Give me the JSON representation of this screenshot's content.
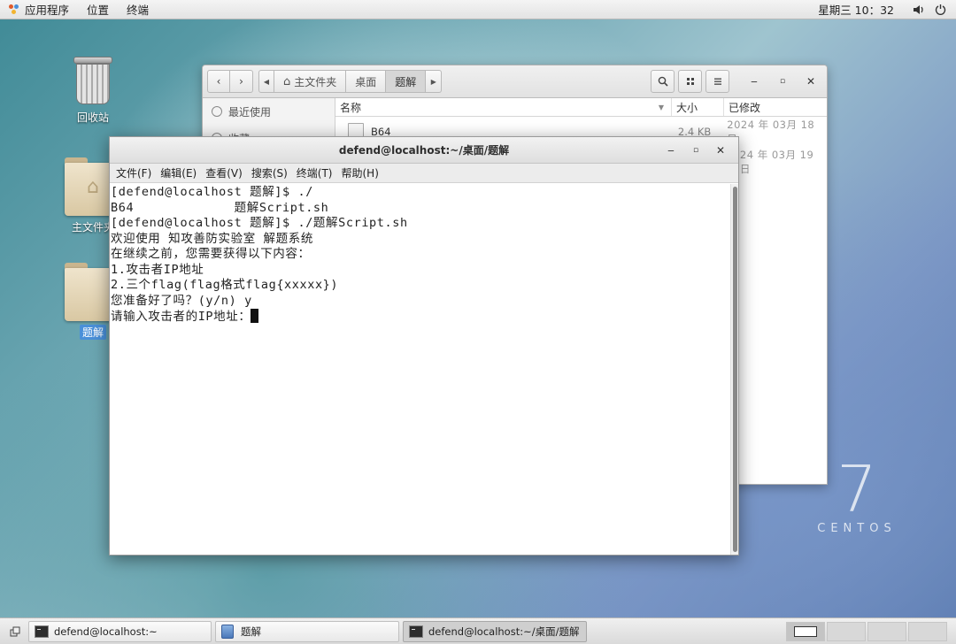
{
  "topbar": {
    "applications": "应用程序",
    "places": "位置",
    "terminal": "终端",
    "clock": "星期三 10：32",
    "volume_icon": "volume-icon",
    "power_icon": "power-icon"
  },
  "desktop": {
    "icons": [
      {
        "label": "回收站"
      },
      {
        "label": "主文件夹"
      },
      {
        "label": "题解"
      }
    ],
    "brand_number": "7",
    "brand_name": "CENTOS"
  },
  "file_manager": {
    "path": [
      "主文件夹",
      "桌面",
      "题解"
    ],
    "sidebar": [
      "最近使用",
      "收藏"
    ],
    "columns": {
      "name": "名称",
      "size": "大小",
      "modified": "已修改"
    },
    "rows": [
      {
        "name": "B64",
        "size": "2.4 KB",
        "modified": "2024 年 03月 18 日"
      },
      {
        "name": "",
        "size": "",
        "modified": "24 年 03月 19 日"
      }
    ]
  },
  "terminal": {
    "title": "defend@localhost:~/桌面/题解",
    "menu": [
      "文件(F)",
      "编辑(E)",
      "查看(V)",
      "搜索(S)",
      "终端(T)",
      "帮助(H)"
    ],
    "lines": [
      "[defend@localhost 题解]$ ./",
      "B64             题解Script.sh",
      "[defend@localhost 题解]$ ./题解Script.sh",
      "欢迎使用 知攻善防实验室 解题系统",
      "在继续之前，您需要获得以下内容：",
      "1.攻击者IP地址",
      "2.三个flag(flag格式flag{xxxxx})",
      "您准备好了吗？(y/n) y",
      "请输入攻击者的IP地址："
    ]
  },
  "taskbar": {
    "tasks": [
      {
        "label": "defend@localhost:~"
      },
      {
        "label": "题解"
      },
      {
        "label": "defend@localhost:~/桌面/题解"
      }
    ]
  }
}
